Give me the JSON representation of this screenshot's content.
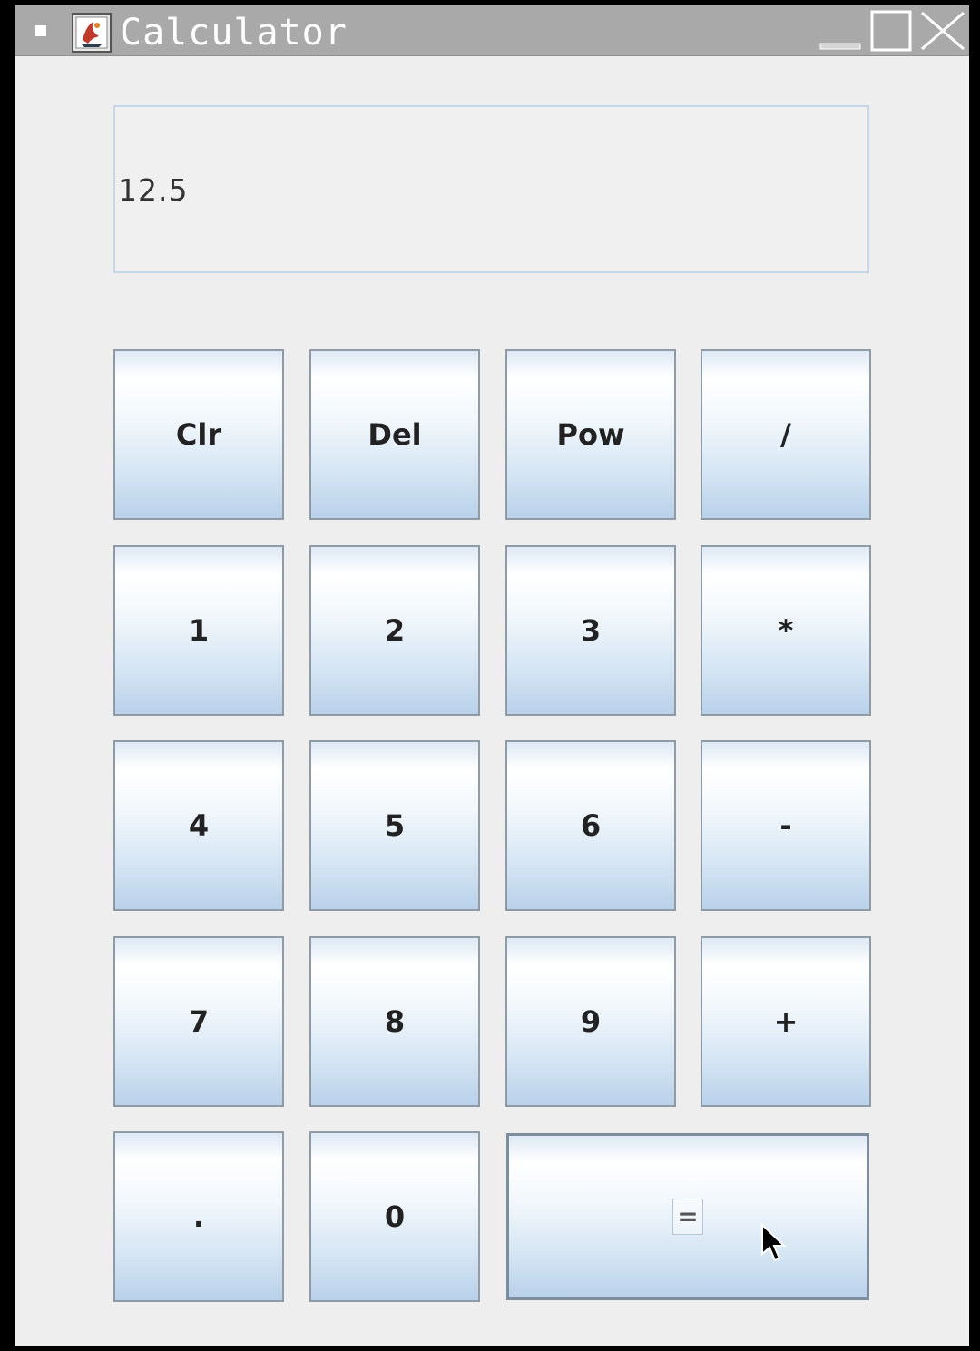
{
  "window": {
    "title": "Calculator",
    "title_color": "#ffffff",
    "titlebar_color": "#a9a9a9",
    "background_color": "#eeeeee"
  },
  "display": {
    "value": "12.5"
  },
  "buttons": {
    "clear": "Clr",
    "delete": "Del",
    "power": "Pow",
    "divide": "/",
    "one": "1",
    "two": "2",
    "three": "3",
    "multiply": "*",
    "four": "4",
    "five": "5",
    "six": "6",
    "subtract": "-",
    "seven": "7",
    "eight": "8",
    "nine": "9",
    "add": "+",
    "decimal": ".",
    "zero": "0",
    "equals": "="
  },
  "icons": {
    "window_menu": "window-menu-icon",
    "app": "java-app-icon",
    "minimize": "minimize-icon",
    "maximize": "maximize-icon",
    "close": "close-icon",
    "cursor": "mouse-pointer-icon"
  },
  "colors": {
    "button_gradient_top": "#ffffff",
    "button_gradient_bottom": "#b9d1ea",
    "button_border": "#8e9aa6",
    "display_border": "#c5d8ea"
  }
}
